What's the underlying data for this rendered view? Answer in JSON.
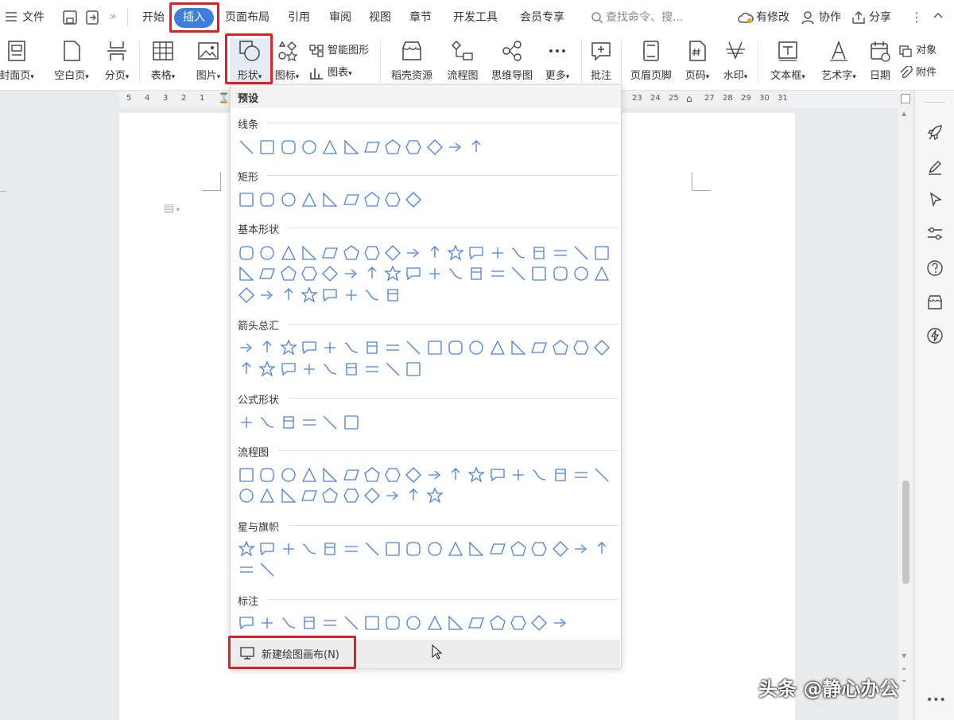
{
  "menubar": {
    "hamburger_label": "文件",
    "tabs": [
      "开始",
      "插入",
      "页面布局",
      "引用",
      "审阅",
      "视图",
      "章节",
      "开发工具",
      "会员专享"
    ],
    "active_tab": "插入",
    "search_placeholder": "查找命令、搜...",
    "right_actions": [
      "有修改",
      "协作",
      "分享"
    ]
  },
  "ribbon": {
    "buttons": {
      "cover": "封面页",
      "blank": "空白页",
      "pagebreak": "分页",
      "table": "表格",
      "picture": "图片",
      "shape": "形状",
      "iconlib": "图标",
      "smartart": "智能图形",
      "chart": "图表",
      "docer": "稻壳资源",
      "flowchart": "流程图",
      "mindmap": "思维导图",
      "more": "更多",
      "comment": "批注",
      "headerfooter": "页眉页脚",
      "pagenum": "页码",
      "watermark": "水印",
      "textbox": "文本框",
      "wordart": "艺术字",
      "date": "日期",
      "object": "对象",
      "attachment": "附件"
    }
  },
  "ruler": {
    "left_ticks": [
      "5",
      "4",
      "3",
      "2",
      "1"
    ],
    "right_ticks": [
      "23",
      "24",
      "25",
      "27",
      "28",
      "29",
      "30",
      "31"
    ]
  },
  "dropdown": {
    "header": "预设",
    "sections": {
      "lines": "线条",
      "rect": "矩形",
      "basic": "基本形状",
      "arrows": "箭头总汇",
      "formula": "公式形状",
      "flow": "流程图",
      "stars": "星与旗帜",
      "callouts": "标注"
    },
    "new_canvas": "新建绘图画布(N)"
  },
  "watermark_text": "头条 @静心办公",
  "colors": {
    "accent": "#3d7ddc",
    "highlight": "#e02020",
    "shape_stroke": "#4a80d8"
  }
}
